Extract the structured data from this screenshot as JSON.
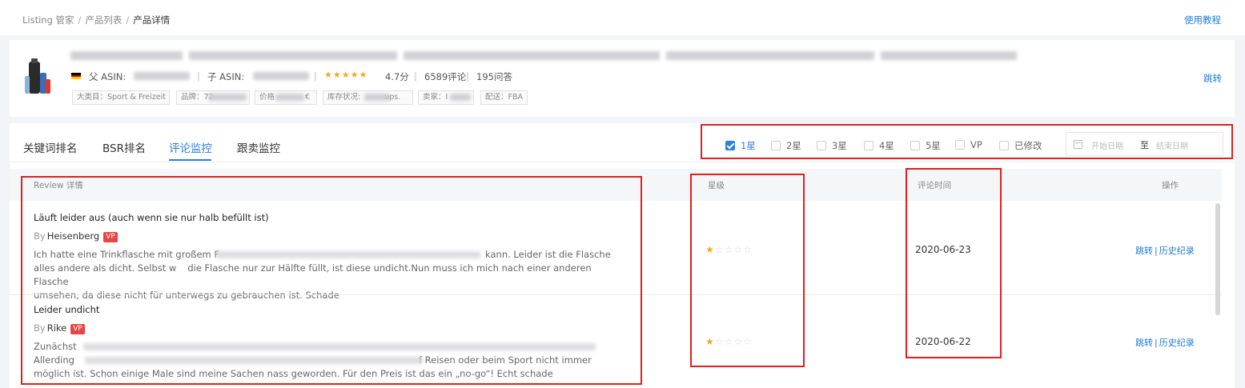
{
  "breadcrumb": {
    "items": [
      "Listing 管家",
      "产品列表",
      "产品详情"
    ]
  },
  "header": {
    "help_label": "使用教程"
  },
  "product": {
    "parent_asin_label": "父 ASIN:",
    "child_asin_label": "子 ASIN:",
    "rating": "4.7分",
    "reviews": "6589评论",
    "qa": "195问答",
    "tags": [
      "大类目：Sport & Freizeit",
      "品牌：72",
      "价格",
      "€",
      "库存状况:",
      "ups.",
      "卖家：I",
      "配送：FBA"
    ],
    "jump_label": "跳转",
    "stars": "★★★★★",
    "flag_colors": [
      "#000000",
      "#dd0000",
      "#ffce00"
    ]
  },
  "tabs": [
    {
      "label": "关键词排名",
      "active": false
    },
    {
      "label": "BSR排名",
      "active": false
    },
    {
      "label": "评论监控",
      "active": true
    },
    {
      "label": "跟卖监控",
      "active": false
    }
  ],
  "filters": [
    {
      "label": "1星",
      "checked": true
    },
    {
      "label": "2星",
      "checked": false
    },
    {
      "label": "3星",
      "checked": false
    },
    {
      "label": "4星",
      "checked": false
    },
    {
      "label": "5星",
      "checked": false
    },
    {
      "label": "VP",
      "checked": false
    },
    {
      "label": "已修改",
      "checked": false
    }
  ],
  "date_range": {
    "start_placeholder": "开始日期",
    "to_label": "至",
    "end_placeholder": "结束日期"
  },
  "table": {
    "columns": [
      "Review 详情",
      "星级",
      "评论时间",
      "操作"
    ],
    "rows": [
      {
        "title": "Läuft leider aus (auch wenn sie nur halb befüllt ist)",
        "by_label": "By",
        "author": "Heisenberg",
        "badge": "VP",
        "text_1": "Ich hatte eine Trinkflasche mit großem F",
        "text_2": "kann. Leider ist die Flasche",
        "text_3": "alles andere als dicht. Selbst w",
        "text_4": "die Flasche nur zur Hälfte füllt, ist diese undicht.Nun muss ich mich nach einer anderen Flasche",
        "text_5": "umsehen, da diese nicht für unterwegs zu gebrauchen ist. Schade",
        "stars_filled": "★",
        "stars_empty": "☆☆☆☆",
        "rating": 1,
        "date": "2020-06-23",
        "op_jump": "跳转",
        "op_sep": "|",
        "op_history": "历史纪录"
      },
      {
        "title": "Leider undicht",
        "by_label": "By",
        "author": "Rike",
        "badge": "VP",
        "text_1": "Zunächst",
        "text_2": "Allerding",
        "text_3": "f Reisen oder beim Sport nicht immer",
        "text_4": "möglich ist. Schon einige Male sind meine Sachen nass geworden. Für den Preis ist das ein „no-go“! Echt schade",
        "stars_filled": "★",
        "stars_empty": "☆☆☆☆",
        "rating": 1,
        "date": "2020-06-22",
        "op_jump": "跳转",
        "op_sep": "|",
        "op_history": "历史纪录"
      }
    ]
  },
  "colors": {
    "accent": "#2e7de0",
    "highlight": "#e02020",
    "star": "#f5a623",
    "vp_badge": "#e94545"
  }
}
